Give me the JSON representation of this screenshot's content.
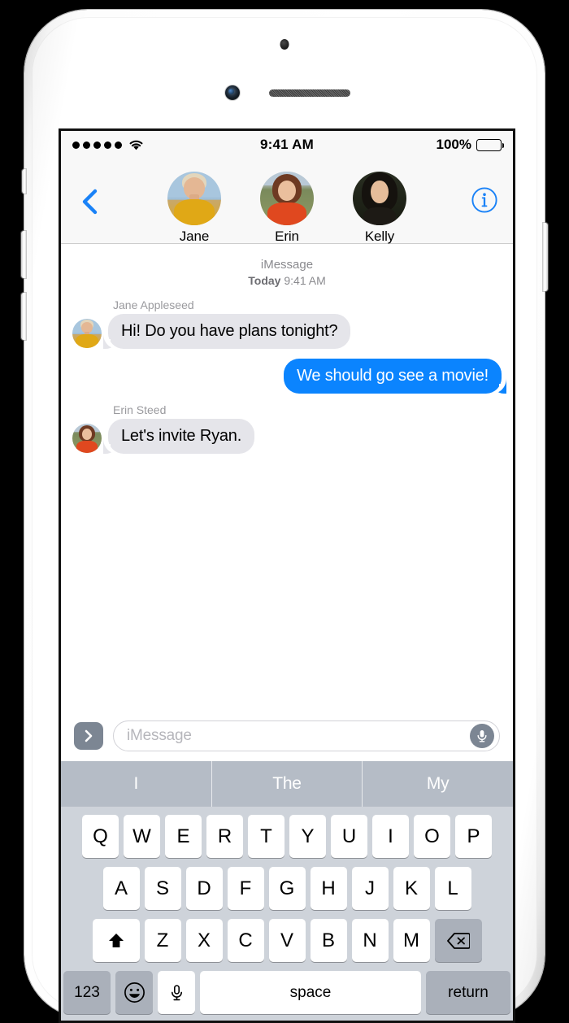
{
  "status_bar": {
    "signal_dots": 5,
    "wifi_icon": "wifi-icon",
    "time": "9:41 AM",
    "battery_percent": "100%",
    "battery_level": 100
  },
  "nav": {
    "back_icon": "chevron-left-icon",
    "info_icon": "info-circle-icon",
    "contacts": [
      {
        "name": "Jane",
        "avatar": "av-jane"
      },
      {
        "name": "Erin",
        "avatar": "av-erin"
      },
      {
        "name": "Kelly",
        "avatar": "av-kelly"
      }
    ]
  },
  "thread": {
    "service": "iMessage",
    "day": "Today",
    "time": "9:41 AM",
    "messages": [
      {
        "sender": "Jane Appleseed",
        "text": "Hi! Do you have plans tonight?",
        "direction": "in",
        "avatar": "av-jane"
      },
      {
        "sender": "",
        "text": "We should go see a movie!",
        "direction": "out",
        "avatar": ""
      },
      {
        "sender": "Erin Steed",
        "text": "Let's invite Ryan.",
        "direction": "in",
        "avatar": "av-erin"
      }
    ]
  },
  "input_bar": {
    "apps_icon": "chevron-right-icon",
    "placeholder": "iMessage",
    "value": "",
    "mic_icon": "microphone-icon"
  },
  "predictive": {
    "suggestions": [
      "I",
      "The",
      "My"
    ]
  },
  "keyboard": {
    "row1": [
      "Q",
      "W",
      "E",
      "R",
      "T",
      "Y",
      "U",
      "I",
      "O",
      "P"
    ],
    "row2": [
      "A",
      "S",
      "D",
      "F",
      "G",
      "H",
      "J",
      "K",
      "L"
    ],
    "row3": [
      "Z",
      "X",
      "C",
      "V",
      "B",
      "N",
      "M"
    ],
    "shift_icon": "shift-arrow-icon",
    "delete_icon": "backspace-icon",
    "numbers_label": "123",
    "emoji_icon": "smiley-face-icon",
    "dictation_icon": "microphone-icon",
    "space_label": "space",
    "return_label": "return"
  },
  "colors": {
    "imessage_blue": "#0b84fe",
    "bubble_gray": "#e5e5ea",
    "keyboard_bg": "#ced3da",
    "predictive_bg": "#b5bcc6",
    "tint": "#1a82f7"
  }
}
